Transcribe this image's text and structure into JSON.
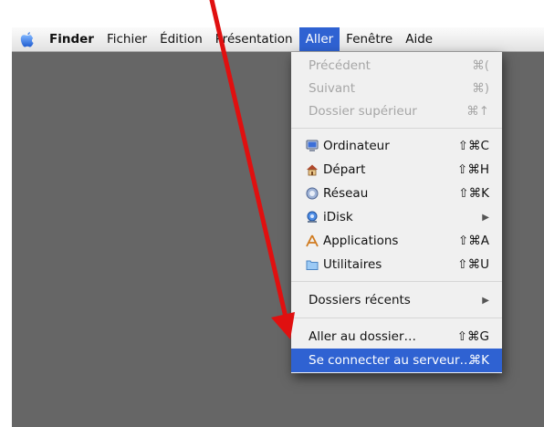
{
  "menubar": {
    "apple_icon": "apple-icon",
    "items": [
      "Finder",
      "Fichier",
      "Édition",
      "Présentation",
      "Aller",
      "Fenêtre",
      "Aide"
    ]
  },
  "menu": {
    "previous": {
      "label": "Précédent",
      "shortcut": "⌘("
    },
    "next": {
      "label": "Suivant",
      "shortcut": "⌘)"
    },
    "enclosing": {
      "label": "Dossier supérieur",
      "shortcut": "⌘↑"
    },
    "computer": {
      "label": "Ordinateur",
      "shortcut": "⇧⌘C",
      "icon": "computer-icon"
    },
    "home": {
      "label": "Départ",
      "shortcut": "⇧⌘H",
      "icon": "home-icon"
    },
    "network": {
      "label": "Réseau",
      "shortcut": "⇧⌘K",
      "icon": "network-icon"
    },
    "idisk": {
      "label": "iDisk",
      "icon": "idisk-icon"
    },
    "applications": {
      "label": "Applications",
      "shortcut": "⇧⌘A",
      "icon": "applications-icon"
    },
    "utilities": {
      "label": "Utilitaires",
      "shortcut": "⇧⌘U",
      "icon": "utilities-folder-icon"
    },
    "recent": {
      "label": "Dossiers récents"
    },
    "goto": {
      "label": "Aller au dossier…",
      "shortcut": "⇧⌘G"
    },
    "connect": {
      "label": "Se connecter au serveur…",
      "shortcut": "⌘K"
    }
  },
  "colors": {
    "highlight": "#2f62d2",
    "annotation_arrow": "#e01010",
    "desktop": "#666666"
  }
}
